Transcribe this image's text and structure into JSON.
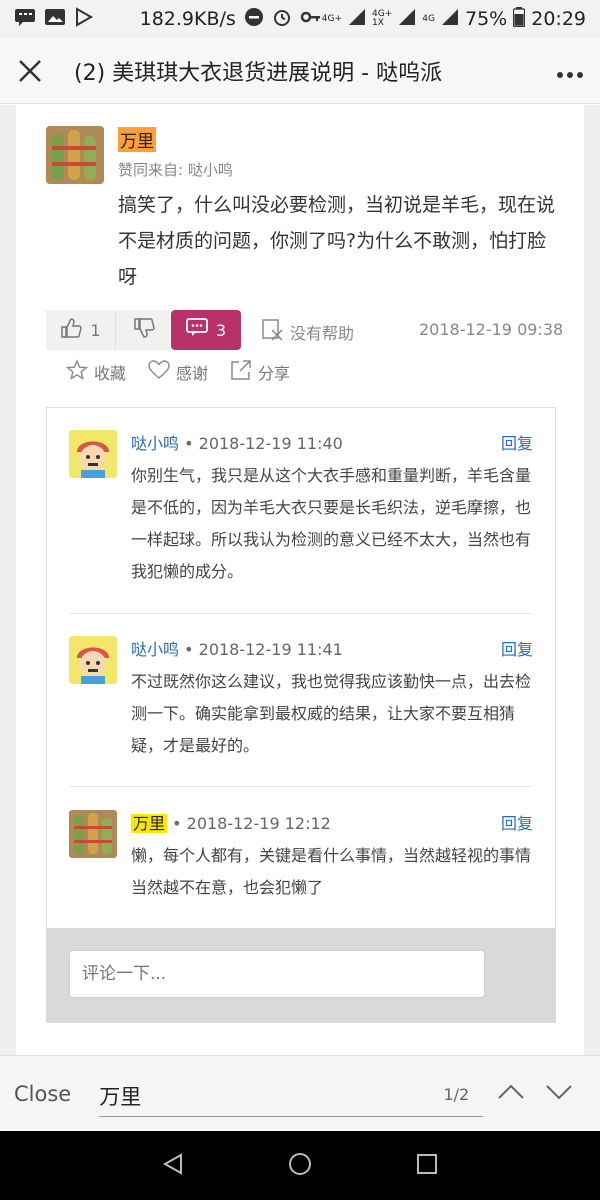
{
  "status_bar": {
    "speed": "182.9KB/s",
    "net1": "4G+",
    "net2": "4G+",
    "net2_sub": "1X",
    "net3": "4G",
    "battery": "75%",
    "time": "20:29"
  },
  "title_bar": {
    "title": "(2) 美琪琪大衣退货进展说明 - 哒呜派"
  },
  "post": {
    "author": "万里",
    "endorse": "赞同来自: 哒小鸣",
    "text": "搞笑了，什么叫没必要检测，当初说是羊毛，现在说不是材质的问题，你测了吗?为什么不敢测，怕打脸呀",
    "upvotes": "1",
    "comments": "3",
    "unhelpful_label": "没有帮助",
    "timestamp": "2018-12-19 09:38",
    "favorite_label": "收藏",
    "thanks_label": "感谢",
    "share_label": "分享"
  },
  "replies": [
    {
      "author": "哒小鸣",
      "time": "• 2018-12-19 11:40",
      "reply_label": "回复",
      "text": "你别生气，我只是从这个大衣手感和重量判断，羊毛含量是不低的，因为羊毛大衣只要是长毛织法，逆毛摩擦，也一样起球。所以我认为检测的意义已经不太大，当然也有我犯懒的成分。"
    },
    {
      "author": "哒小鸣",
      "time": "• 2018-12-19 11:41",
      "reply_label": "回复",
      "text": "不过既然你这么建议，我也觉得我应该勤快一点，出去检测一下。确实能拿到最权威的结果，让大家不要互相猜疑，才是最好的。"
    },
    {
      "author": "万里",
      "time": "• 2018-12-19 12:12",
      "reply_label": "回复",
      "text": "懒，每个人都有，关键是看什么事情，当然越轻视的事情当然越不在意，也会犯懒了"
    }
  ],
  "comment_input": {
    "placeholder": "评论一下..."
  },
  "find_bar": {
    "close_label": "Close",
    "query": "万里",
    "count": "1/2"
  },
  "colors": {
    "accent": "#b8326a",
    "link": "#2a6bbd",
    "highlight_orange": "#ff9f3a",
    "highlight_yellow": "#ffe600"
  }
}
